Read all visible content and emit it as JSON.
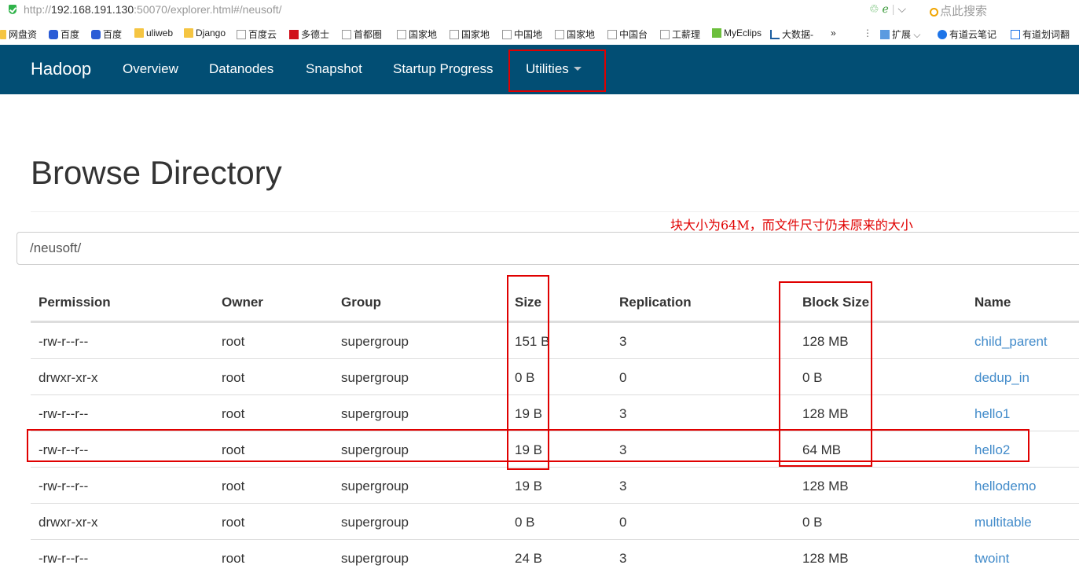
{
  "browser": {
    "url_prefix": "http://",
    "url_host": "192.168.191.130",
    "url_rest": ":50070/explorer.html#/neusoft/",
    "search_placeholder": "点此搜索",
    "bookmarks": [
      "网盘资",
      "百度",
      "百度",
      "uliweb",
      "Django",
      "百度云",
      "多德士",
      "首都圈",
      "国家地",
      "国家地",
      "中国地",
      "国家地",
      "中国台",
      "工薪理",
      "MyEclips",
      "大数据-",
      "»",
      "扩展",
      "有道云笔记",
      "有道划词翻"
    ]
  },
  "navbar": {
    "brand": "Hadoop",
    "links": [
      "Overview",
      "Datanodes",
      "Snapshot",
      "Startup Progress",
      "Utilities"
    ]
  },
  "page": {
    "title": "Browse Directory",
    "annotation": "块大小为64M，而文件尺寸仍未原来的大小",
    "path": "/neusoft/"
  },
  "table": {
    "headers": [
      "Permission",
      "Owner",
      "Group",
      "Size",
      "Replication",
      "Block Size",
      "Name"
    ],
    "rows": [
      [
        "-rw-r--r--",
        "root",
        "supergroup",
        "151 B",
        "3",
        "128 MB",
        "child_parent"
      ],
      [
        "drwxr-xr-x",
        "root",
        "supergroup",
        "0 B",
        "0",
        "0 B",
        "dedup_in"
      ],
      [
        "-rw-r--r--",
        "root",
        "supergroup",
        "19 B",
        "3",
        "128 MB",
        "hello1"
      ],
      [
        "-rw-r--r--",
        "root",
        "supergroup",
        "19 B",
        "3",
        "64 MB",
        "hello2"
      ],
      [
        "-rw-r--r--",
        "root",
        "supergroup",
        "19 B",
        "3",
        "128 MB",
        "hellodemo"
      ],
      [
        "drwxr-xr-x",
        "root",
        "supergroup",
        "0 B",
        "0",
        "0 B",
        "multitable"
      ],
      [
        "-rw-r--r--",
        "root",
        "supergroup",
        "24 B",
        "3",
        "128 MB",
        "twoint"
      ]
    ]
  },
  "colors": {
    "navbar": "#024e74",
    "link": "#428bca",
    "annotation": "#e00000"
  }
}
